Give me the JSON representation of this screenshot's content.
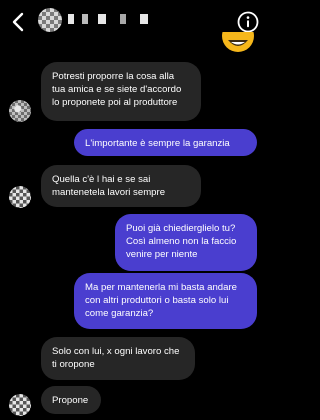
{
  "header": {
    "back_icon": "chevron-left-icon",
    "info_icon": "info-circle-icon"
  },
  "messages": [
    {
      "direction": "incoming",
      "text": "Potresti proporre la cosa alla tua amica e se siete d'accordo lo proponete poi al produttore"
    },
    {
      "direction": "outgoing",
      "text": "L'importante è sempre la garanzia"
    },
    {
      "direction": "incoming",
      "text": "Quella c'è l hai e se sai mantenetela lavori sempre"
    },
    {
      "direction": "outgoing",
      "text": "Puoi già chiedierglielo tu? Così almeno non la faccio venire per niente"
    },
    {
      "direction": "outgoing",
      "text": "Ma per mantenerla mi basta andare con altri produttori o basta solo lui come garanzia?"
    },
    {
      "direction": "incoming",
      "text": "Solo con lui, x ogni lavoro che ti oropone"
    },
    {
      "direction": "incoming",
      "text": "Propone"
    }
  ],
  "colors": {
    "background": "#000000",
    "incoming_bubble": "#262626",
    "outgoing_bubble": "#4a3ecf",
    "text": "#ffffff"
  }
}
